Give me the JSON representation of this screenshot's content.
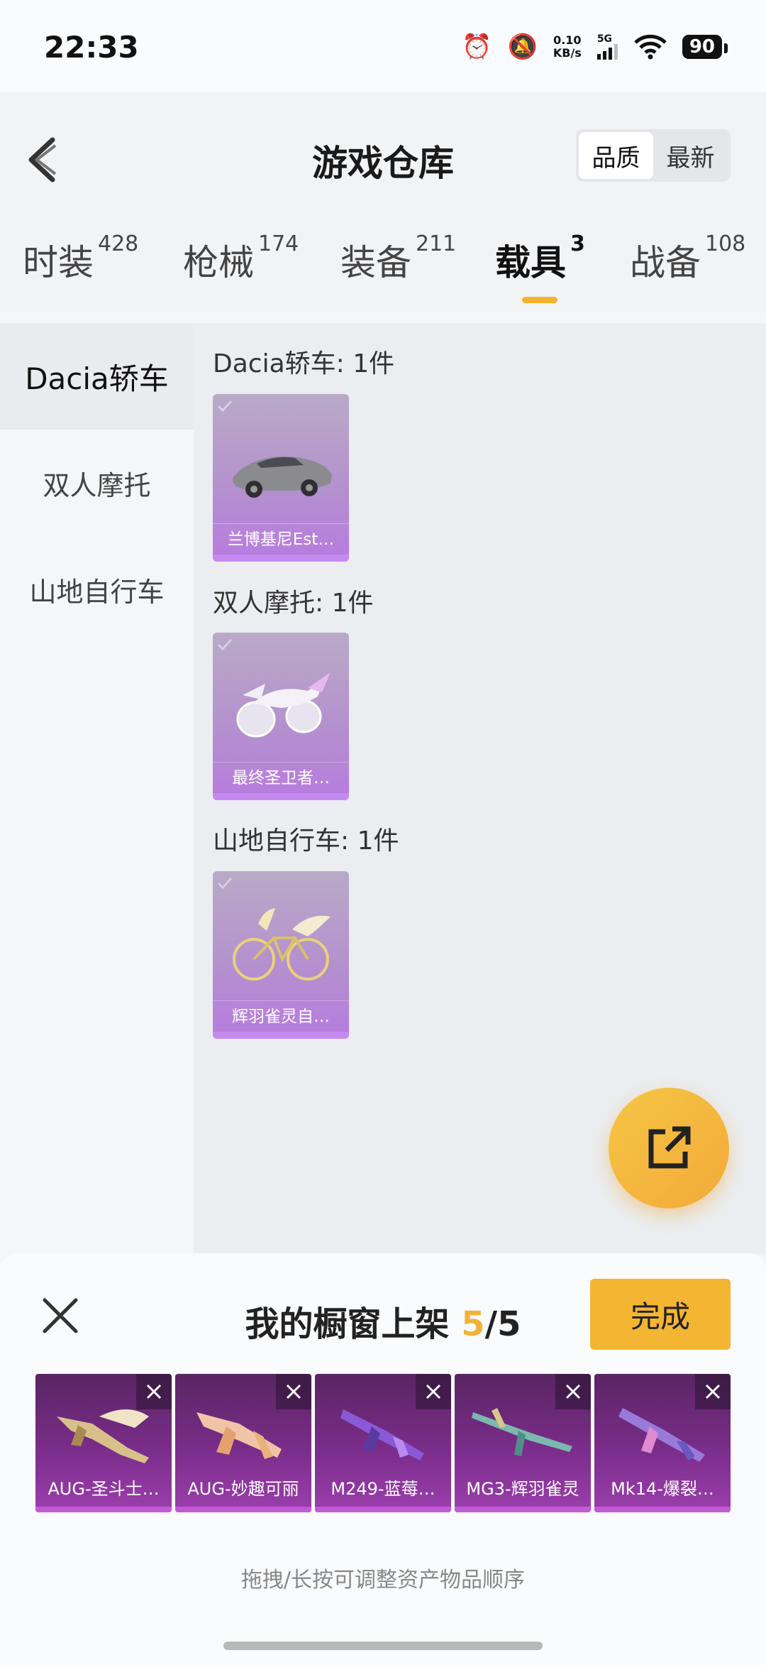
{
  "status": {
    "time": "22:33",
    "net_speed": "0.10",
    "net_unit": "KB/s",
    "network": "5G",
    "battery": "90"
  },
  "header": {
    "title": "游戏仓库",
    "sort_options": [
      "品质",
      "最新"
    ],
    "active_sort": "品质"
  },
  "categories": [
    {
      "label": "时装",
      "count": "428"
    },
    {
      "label": "枪械",
      "count": "174"
    },
    {
      "label": "装备",
      "count": "211"
    },
    {
      "label": "载具",
      "count": "3"
    },
    {
      "label": "战备",
      "count": "108"
    }
  ],
  "active_category": "载具",
  "sidebar": {
    "items": [
      "Dacia轿车",
      "双人摩托",
      "山地自行车"
    ],
    "active": "Dacia轿车"
  },
  "groups": [
    {
      "title": "Dacia轿车: 1件",
      "items": [
        {
          "name": "兰博基尼Est…",
          "icon": "car-icon"
        }
      ]
    },
    {
      "title": "双人摩托: 1件",
      "items": [
        {
          "name": "最终圣卫者…",
          "icon": "motorcycle-icon"
        }
      ]
    },
    {
      "title": "山地自行车: 1件",
      "items": [
        {
          "name": "辉羽雀灵自…",
          "icon": "bicycle-icon"
        }
      ]
    }
  ],
  "share_button_icon": "share-icon",
  "showcase": {
    "title_prefix": "我的橱窗上架",
    "count": "5",
    "total": "/5",
    "done_label": "完成",
    "items": [
      "AUG-圣斗士…",
      "AUG-妙趣可丽",
      "M249-蓝莓…",
      "MG3-辉羽雀灵",
      "Mk14-爆裂…"
    ],
    "hint": "拖拽/长按可调整资产物品顺序"
  },
  "colors": {
    "accent": "#f4b533",
    "purple_card": "#b77be0",
    "showcase_card": "#7a2d8a"
  }
}
